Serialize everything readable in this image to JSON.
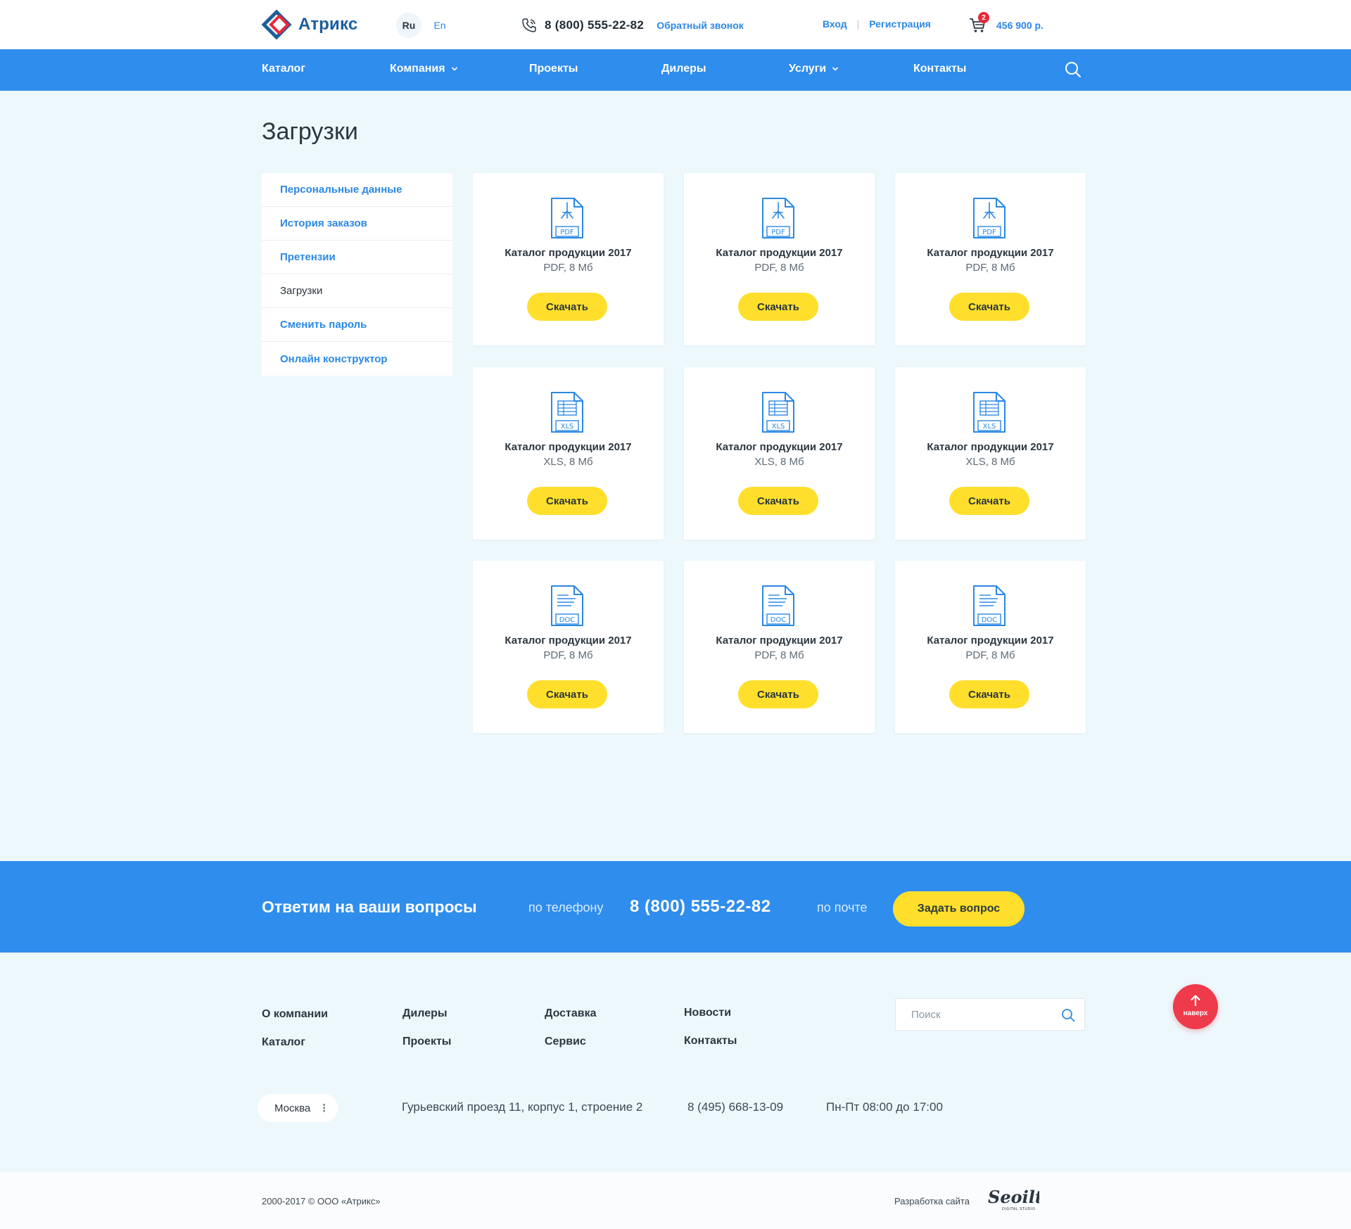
{
  "header": {
    "logo_text": "Атрикс",
    "lang_ru": "Ru",
    "lang_en": "En",
    "phone": "8 (800) 555-22-82",
    "callback": "Обратный звонок",
    "login": "Вход",
    "register": "Регистрация",
    "cart_count": "2",
    "cart_total": "456 900 р."
  },
  "nav": {
    "items": [
      "Каталог",
      "Компания",
      "Проекты",
      "Дилеры",
      "Услуги",
      "Контакты"
    ]
  },
  "page": {
    "title": "Загрузки"
  },
  "sidebar": {
    "items": [
      {
        "label": "Персональные данные",
        "active": false
      },
      {
        "label": "История заказов",
        "active": false
      },
      {
        "label": "Претензии",
        "active": false
      },
      {
        "label": "Загрузки",
        "active": true
      },
      {
        "label": "Сменить пароль",
        "active": false
      },
      {
        "label": "Онлайн конструктор",
        "active": false
      }
    ]
  },
  "downloads": [
    {
      "icon": "pdf-file-icon",
      "type_label": "PDF",
      "title": "Каталог продукции 2017",
      "meta": "PDF, 8 Мб",
      "button": "Скачать"
    },
    {
      "icon": "pdf-file-icon",
      "type_label": "PDF",
      "title": "Каталог продукции 2017",
      "meta": "PDF, 8 Мб",
      "button": "Скачать"
    },
    {
      "icon": "pdf-file-icon",
      "type_label": "PDF",
      "title": "Каталог продукции 2017",
      "meta": "PDF, 8 Мб",
      "button": "Скачать"
    },
    {
      "icon": "xls-file-icon",
      "type_label": "XLS",
      "title": "Каталог продукции 2017",
      "meta": "XLS, 8 Мб",
      "button": "Скачать"
    },
    {
      "icon": "xls-file-icon",
      "type_label": "XLS",
      "title": "Каталог продукции 2017",
      "meta": "XLS, 8 Мб",
      "button": "Скачать"
    },
    {
      "icon": "xls-file-icon",
      "type_label": "XLS",
      "title": "Каталог продукции 2017",
      "meta": "XLS, 8 Мб",
      "button": "Скачать"
    },
    {
      "icon": "doc-file-icon",
      "type_label": "DOC",
      "title": "Каталог продукции 2017",
      "meta": "PDF, 8 Мб",
      "button": "Скачать"
    },
    {
      "icon": "doc-file-icon",
      "type_label": "DOC",
      "title": "Каталог продукции 2017",
      "meta": "PDF, 8 Мб",
      "button": "Скачать"
    },
    {
      "icon": "doc-file-icon",
      "type_label": "DOC",
      "title": "Каталог продукции 2017",
      "meta": "PDF, 8 Мб",
      "button": "Скачать"
    }
  ],
  "cta": {
    "title": "Ответим на ваши вопросы",
    "by_phone": "по телефону",
    "phone": "8 (800) 555-22-82",
    "by_mail": "по почте",
    "button": "Задать вопрос"
  },
  "footer": {
    "links": [
      "О компании",
      "Каталог",
      "Дилеры",
      "Проекты",
      "Доставка",
      "Сервис",
      "Новости",
      "Контакты"
    ],
    "search_placeholder": "Поиск",
    "to_top": "наверх",
    "city": "Москва",
    "address": "Гурьевский проезд 11, корпус 1, строение 2",
    "phone": "8 (495) 668-13-09",
    "hours": "Пн-Пт 08:00 до 17:00",
    "copyright": "2000-2017 © ООО «Атрикс»",
    "developer": "Разработка сайта",
    "developer_logo": "Seoilt"
  },
  "colors": {
    "primary": "#2f8ded",
    "accent_yellow": "#ffdf2b",
    "page_bg": "#edf8fd",
    "badge_red": "#e8283b",
    "to_top_red": "#ef3a4b"
  }
}
